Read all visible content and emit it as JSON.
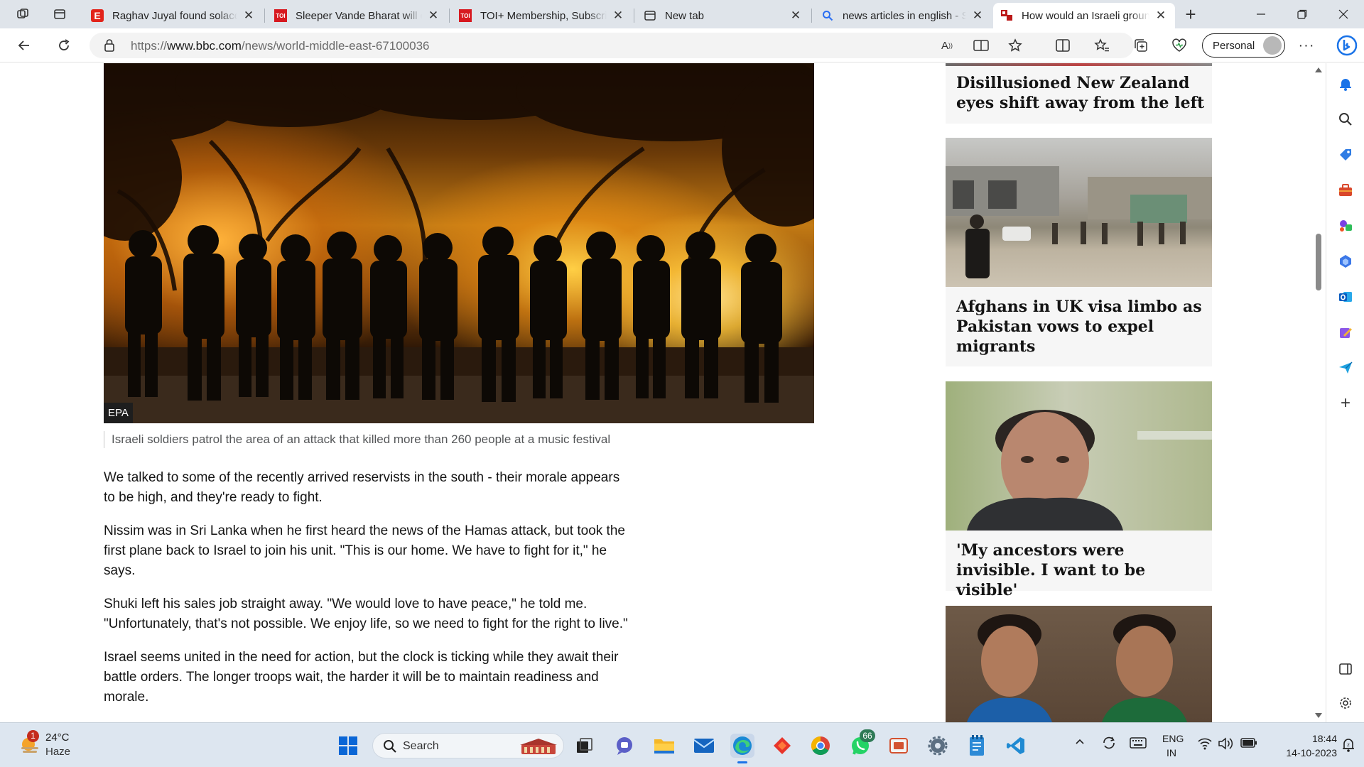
{
  "browser": {
    "tabs": [
      {
        "title": "Raghav Juyal found solace in",
        "favicon_text": "E",
        "favicon_color": "#e2231a"
      },
      {
        "title": "Sleeper Vande Bharat will co",
        "favicon_text": "TOI",
        "favicon_color": "#d71920"
      },
      {
        "title": "TOI+ Membership, Subscrip",
        "favicon_text": "TOI",
        "favicon_color": "#d71920"
      },
      {
        "title": "New tab",
        "favicon_text": "",
        "favicon_color": "#333333"
      },
      {
        "title": "news articles in english - S",
        "favicon_text": "",
        "favicon_color": "#2a6ef2"
      },
      {
        "title": "How would an Israeli groun",
        "favicon_text": "",
        "favicon_color": "#bb1919"
      }
    ],
    "active_tab_index": 5,
    "url_prefix": "https://",
    "url_host": "www.bbc.com",
    "url_path": "/news/world-middle-east-67100036",
    "profile_label": "Personal"
  },
  "article": {
    "photo_credit": "EPA",
    "caption": "Israeli soldiers patrol the area of an attack that killed more than 260 people at a music festival",
    "paragraphs": [
      "We talked to some of the recently arrived reservists in the south - their morale appears to be high, and they're ready to fight.",
      "Nissim was in Sri Lanka when he first heard the news of the Hamas attack, but took the first plane back to Israel to join his unit. \"This is our home. We have to fight for it,\" he says.",
      "Shuki left his sales job straight away. \"We would love to have peace,\" he told me. \"Unfortunately, that's not possible. We enjoy life, so we need to fight for the right to live.\"",
      "Israel seems united in the need for action, but the clock is ticking while they await their battle orders. The longer troops wait, the harder it will be to maintain readiness and morale."
    ]
  },
  "rail": {
    "cards": [
      {
        "headline": "Disillusioned New Zealand eyes shift away from the left"
      },
      {
        "headline": "Afghans in UK visa limbo as Pakistan vows to expel migrants"
      },
      {
        "headline": "'My ancestors were invisible. I want to be visible'"
      },
      {
        "headline": ""
      }
    ]
  },
  "taskbar": {
    "weather_temp": "24°C",
    "weather_desc": "Haze",
    "weather_badge": "1",
    "search_label": "Search",
    "whatsapp_badge": "66",
    "lang_line1": "ENG",
    "lang_line2": "IN",
    "time": "18:44",
    "date": "14-10-2023"
  },
  "colors": {
    "bbc_red": "#bb1919",
    "edge_blue": "#0c59c4",
    "taskbar_bg": "#dde6f0"
  }
}
